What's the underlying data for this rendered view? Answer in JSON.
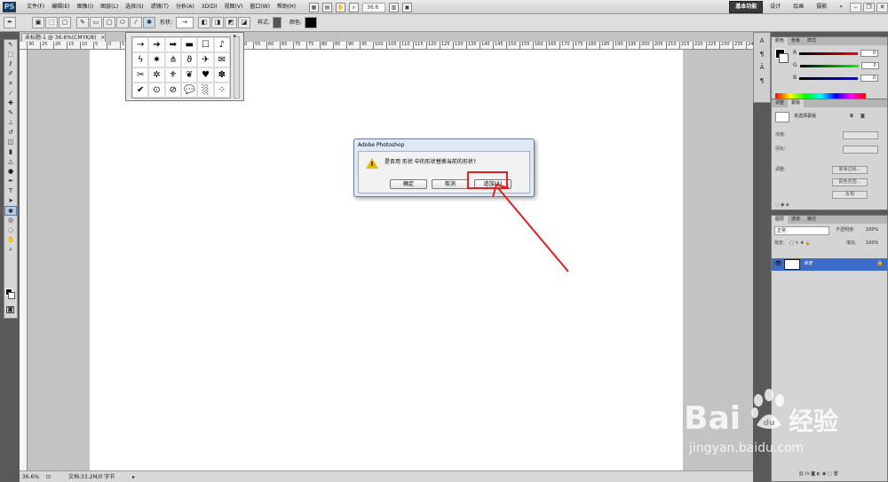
{
  "app": {
    "logo": "PS"
  },
  "menubar": {
    "items": [
      "文件(F)",
      "编辑(E)",
      "图像(I)",
      "图层(L)",
      "选择(S)",
      "滤镜(T)",
      "分析(A)",
      "3D(D)",
      "视图(V)",
      "窗口(W)",
      "帮助(H)"
    ],
    "zoom": "36.6",
    "workspaces": [
      "基本功能",
      "设计",
      "绘画",
      "摄影"
    ],
    "active_workspace": "基本功能",
    "more": "»"
  },
  "options": {
    "shape_label": "形状:",
    "style_label": "样式:",
    "color_label": "颜色:",
    "shape_value": "→"
  },
  "document": {
    "tab_title": "未标题-1 @ 36.6%(CMYK/8)",
    "ruler_ticks": [
      "30",
      "25",
      "20",
      "15",
      "10",
      "5",
      "0",
      "5",
      "10",
      "15",
      "20",
      "25",
      "30",
      "35",
      "40",
      "45",
      "50",
      "55",
      "60",
      "65",
      "70",
      "75",
      "80",
      "85",
      "90",
      "95",
      "100",
      "105",
      "110",
      "115",
      "120",
      "125",
      "130",
      "135",
      "140",
      "145",
      "150",
      "155",
      "160",
      "165",
      "170",
      "175",
      "180",
      "185",
      "190",
      "195",
      "200",
      "205",
      "210",
      "215",
      "220",
      "225",
      "230",
      "235",
      "240"
    ]
  },
  "status": {
    "zoom": "36.6%",
    "info": "文档:33.2M/0 字节"
  },
  "shape_picker": {
    "cells": [
      "→",
      "➔",
      "➡",
      "▬",
      "☐",
      "♪",
      "ϟ",
      "✷",
      "⋔",
      "ϑ",
      "✈",
      "✉",
      "✂",
      "✲",
      "⚜",
      "❦",
      "♥",
      "✽",
      "✔",
      "⊙",
      "⊘",
      "💬",
      "░",
      "⁘"
    ]
  },
  "dialog": {
    "title": "Adobe Photoshop",
    "message": "是否用 形状 中的形状替换当前的形状?",
    "ok": "确定",
    "cancel": "取消",
    "append": "追加(A)"
  },
  "panels": {
    "color_tabs": [
      "颜色",
      "色板",
      "样式"
    ],
    "channels": [
      {
        "name": "R",
        "value": "0"
      },
      {
        "name": "G",
        "value": "0"
      },
      {
        "name": "B",
        "value": "0"
      }
    ],
    "adjust_tabs": [
      "调整",
      "蒙版"
    ],
    "mask_label": "未选择蒙版",
    "density": "浓度:",
    "feather": "羽化:",
    "refine": "调整:",
    "mask_edge": "蒙版边缘...",
    "color_range": "颜色范围...",
    "invert": "反相",
    "layer_tabs": [
      "图层",
      "通道",
      "路径"
    ],
    "blend": "正常",
    "opacity_label": "不透明度:",
    "opacity": "100%",
    "lock_label": "锁定:",
    "fill_label": "填充:",
    "fill": "100%",
    "layer_name": "背景"
  },
  "watermark": {
    "brand": "Bai",
    "brand2": "du",
    "cn": "经验",
    "url": "jingyan.baidu.com"
  },
  "colors": {
    "highlight": "#e02020",
    "arrow": "#e02020",
    "layer_selected": "#3d6cc8"
  }
}
